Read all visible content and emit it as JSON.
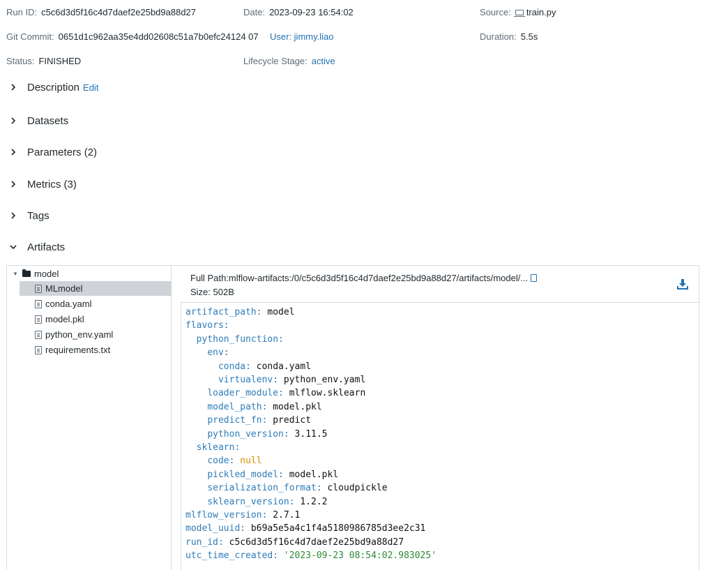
{
  "run": {
    "run_id_label": "Run ID:",
    "run_id": "c5c6d3d5f16c4d7daef2e25bd9a88d27",
    "date_label": "Date:",
    "date": "2023-09-23 16:54:02",
    "source_label": "Source:",
    "source": "train.py",
    "git_label": "Git Commit:",
    "git_commit": "0651d1c962aa35e4dd02608c51a7b0efc24124 07",
    "user_link": "User: jimmy.liao",
    "duration_label": "Duration:",
    "duration": "5.5s",
    "status_label": "Status:",
    "status": "FINISHED",
    "lifecycle_label": "Lifecycle Stage:",
    "lifecycle": "active"
  },
  "sections": {
    "description": "Description",
    "edit": "Edit",
    "datasets": "Datasets",
    "parameters": "Parameters (2)",
    "metrics": "Metrics (3)",
    "tags": "Tags",
    "artifacts": "Artifacts"
  },
  "tree": {
    "folder": "model",
    "files": [
      "MLmodel",
      "conda.yaml",
      "model.pkl",
      "python_env.yaml",
      "requirements.txt"
    ],
    "selected": "MLmodel"
  },
  "detail": {
    "full_path_label": "Full Path:",
    "full_path": "mlflow-artifacts:/0/c5c6d3d5f16c4d7daef2e25bd9a88d27/artifacts/model/...",
    "size_label": "Size:",
    "size": "502B"
  },
  "code": {
    "lines": [
      {
        "indent": "",
        "key": "artifact_path",
        "value": "model",
        "vtype": "v"
      },
      {
        "indent": "",
        "key": "flavors",
        "value": "",
        "vtype": "v"
      },
      {
        "indent": "  ",
        "key": "python_function",
        "value": "",
        "vtype": "v"
      },
      {
        "indent": "    ",
        "key": "env",
        "value": "",
        "vtype": "v"
      },
      {
        "indent": "      ",
        "key": "conda",
        "value": "conda.yaml",
        "vtype": "v"
      },
      {
        "indent": "      ",
        "key": "virtualenv",
        "value": "python_env.yaml",
        "vtype": "v"
      },
      {
        "indent": "    ",
        "key": "loader_module",
        "value": "mlflow.sklearn",
        "vtype": "v"
      },
      {
        "indent": "    ",
        "key": "model_path",
        "value": "model.pkl",
        "vtype": "v"
      },
      {
        "indent": "    ",
        "key": "predict_fn",
        "value": "predict",
        "vtype": "v"
      },
      {
        "indent": "    ",
        "key": "python_version",
        "value": "3.11.5",
        "vtype": "v"
      },
      {
        "indent": "  ",
        "key": "sklearn",
        "value": "",
        "vtype": "v"
      },
      {
        "indent": "    ",
        "key": "code",
        "value": "null",
        "vtype": "n"
      },
      {
        "indent": "    ",
        "key": "pickled_model",
        "value": "model.pkl",
        "vtype": "v"
      },
      {
        "indent": "    ",
        "key": "serialization_format",
        "value": "cloudpickle",
        "vtype": "v"
      },
      {
        "indent": "    ",
        "key": "sklearn_version",
        "value": "1.2.2",
        "vtype": "v"
      },
      {
        "indent": "",
        "key": "mlflow_version",
        "value": "2.7.1",
        "vtype": "v"
      },
      {
        "indent": "",
        "key": "model_uuid",
        "value": "b69a5e5a4c1f4a5180986785d3ee2c31",
        "vtype": "v"
      },
      {
        "indent": "",
        "key": "run_id",
        "value": "c5c6d3d5f16c4d7daef2e25bd9a88d27",
        "vtype": "v"
      },
      {
        "indent": "",
        "key": "utc_time_created",
        "value": "'2023-09-23 08:54:02.983025'",
        "vtype": "s"
      }
    ]
  },
  "colors": {
    "link": "#2272b4",
    "code_key": "#2e7cb8",
    "code_null": "#d98b00",
    "code_string": "#2e8a36",
    "selected_bg": "#cfd3d8"
  }
}
